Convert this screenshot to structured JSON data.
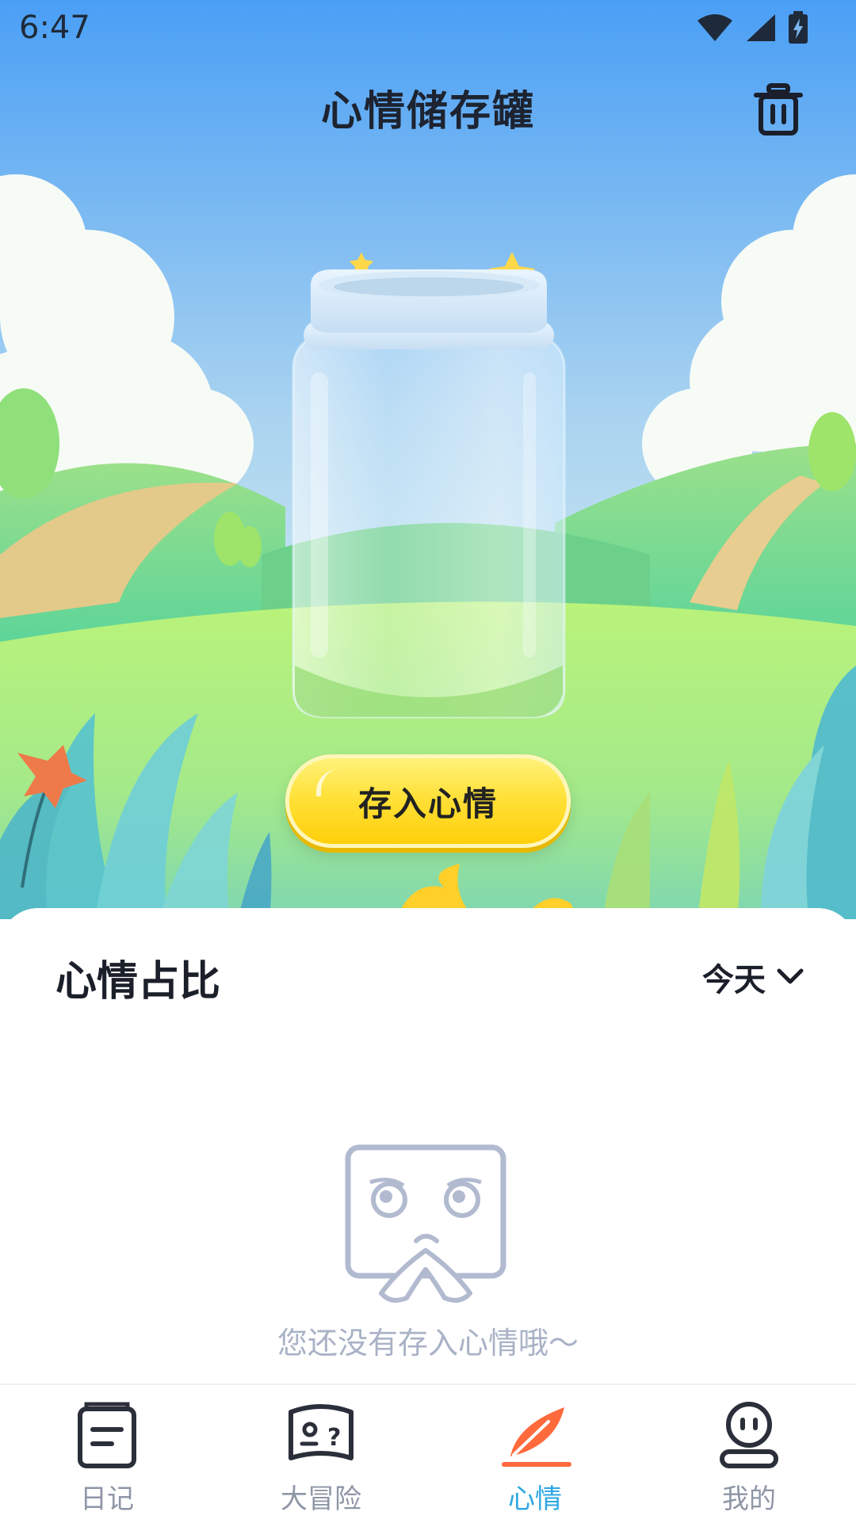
{
  "status_bar": {
    "time": "6:47"
  },
  "header": {
    "title": "心情储存罐"
  },
  "hero": {
    "button_label": "存入心情"
  },
  "panel": {
    "title": "心情占比",
    "range_selector": {
      "selected": "今天"
    },
    "empty_text": "您还没有存入心情哦～"
  },
  "tabbar": {
    "active_color": "#2da7e2",
    "items": [
      {
        "label": "日记",
        "icon": "diary-icon"
      },
      {
        "label": "大冒险",
        "icon": "adventure-icon"
      },
      {
        "label": "心情",
        "icon": "feather-icon"
      },
      {
        "label": "我的",
        "icon": "profile-icon"
      }
    ]
  }
}
